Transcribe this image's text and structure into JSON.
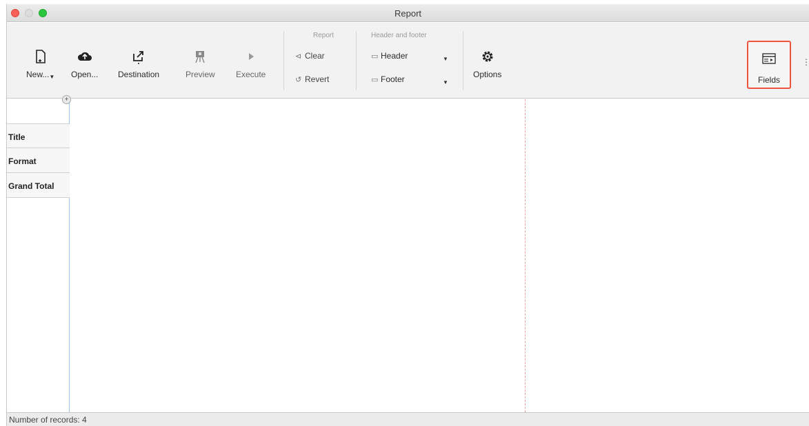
{
  "window": {
    "title": "Report"
  },
  "toolbar": {
    "new_label": "New...",
    "open_label": "Open...",
    "destination_label": "Destination",
    "preview_label": "Preview",
    "execute_label": "Execute",
    "report_group": {
      "title": "Report",
      "clear_label": "Clear",
      "revert_label": "Revert"
    },
    "header_footer_group": {
      "title": "Header and footer",
      "header_label": "Header",
      "footer_label": "Footer"
    },
    "options_label": "Options",
    "fields_label": "Fields"
  },
  "sections": [
    {
      "label": "Title"
    },
    {
      "label": "Format"
    },
    {
      "label": "Grand Total"
    }
  ],
  "status": {
    "text": "Number of records: 4"
  },
  "colors": {
    "highlight": "#f0533d",
    "margin_line": "#f2a0a0",
    "close": "#fc5f57",
    "maximize": "#2bc73f"
  }
}
